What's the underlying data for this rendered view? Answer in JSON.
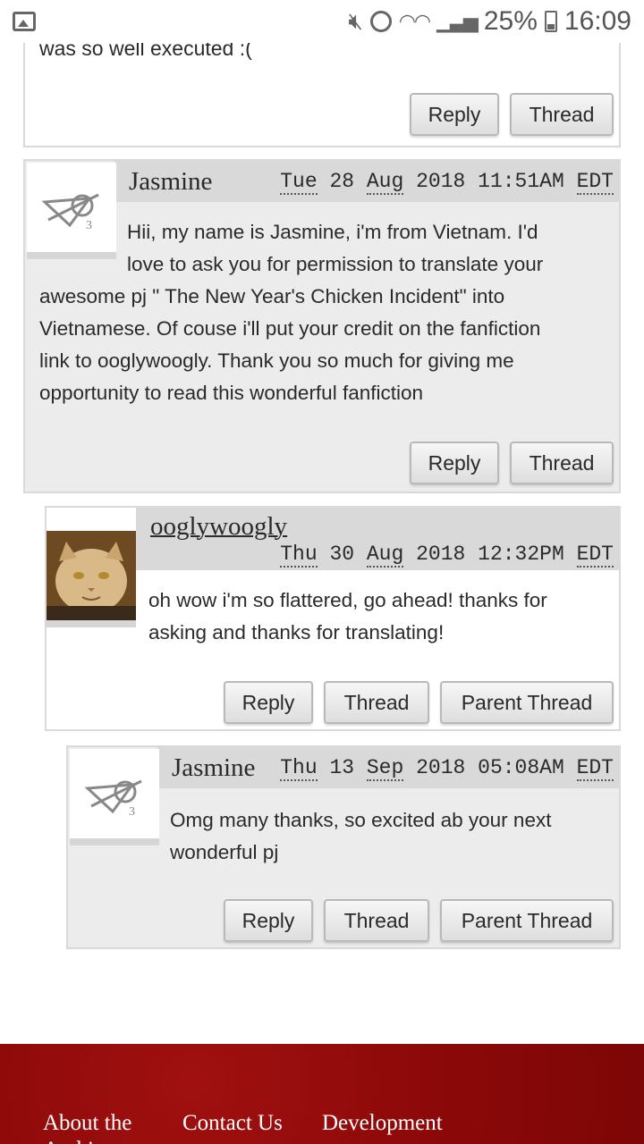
{
  "status_bar": {
    "icons": [
      "gallery-icon",
      "mute-icon",
      "alarm-icon",
      "wifi-icon",
      "signal-icon",
      "battery-icon"
    ],
    "battery": "25%",
    "time": "16:09"
  },
  "comments": [
    {
      "body_tail": "was so well executed :(",
      "buttons": [
        "Reply",
        "Thread"
      ]
    },
    {
      "poster": "Jasmine",
      "date": {
        "day": "Tue",
        "dd": "28",
        "mon": "Aug",
        "year": "2018",
        "time": "11:51AM",
        "tz": "EDT"
      },
      "body": "Hii, my name is Jasmine, i'm from Vietnam. I'd love to ask you for permission to translate your awesome pj \" The New Year's Chicken Incident\" into Vietnamese. Of couse i'll put your credit on the fanfiction link to ooglywoogly. Thank you so much for giving me opportunity to read this wonderful fanfiction",
      "body_lines": [
        "Hii, my name is Jasmine, i'm from Vietnam. I'd",
        "love to ask you for permission to translate your",
        "awesome pj \" The New Year's Chicken Incident\" into",
        "Vietnamese. Of couse i'll put your credit on the fanfiction",
        "link to ooglywoogly. Thank you so much for giving me",
        "opportunity to read this wonderful fanfiction"
      ],
      "buttons": [
        "Reply",
        "Thread"
      ]
    },
    {
      "poster": "ooglywoogly",
      "date": {
        "day": "Thu",
        "dd": "30",
        "mon": "Aug",
        "year": "2018",
        "time": "12:32PM",
        "tz": "EDT"
      },
      "body_lines": [
        "oh wow i'm so flattered, go ahead! thanks for",
        "asking and thanks for translating!"
      ],
      "buttons": [
        "Reply",
        "Thread",
        "Parent Thread"
      ]
    },
    {
      "poster": "Jasmine",
      "date": {
        "day": "Thu",
        "dd": "13",
        "mon": "Sep",
        "year": "2018",
        "time": "05:08AM",
        "tz": "EDT"
      },
      "body_lines": [
        "Omg many thanks, so excited ab your next",
        "wonderful pj"
      ],
      "buttons": [
        "Reply",
        "Thread",
        "Parent Thread"
      ]
    }
  ],
  "footer": {
    "links": [
      "About the Archive",
      "Contact Us",
      "Development"
    ]
  },
  "colors": {
    "header_gray": "#d9d9d9",
    "body_gray": "#ececec",
    "footer_red": "#8a0808"
  }
}
